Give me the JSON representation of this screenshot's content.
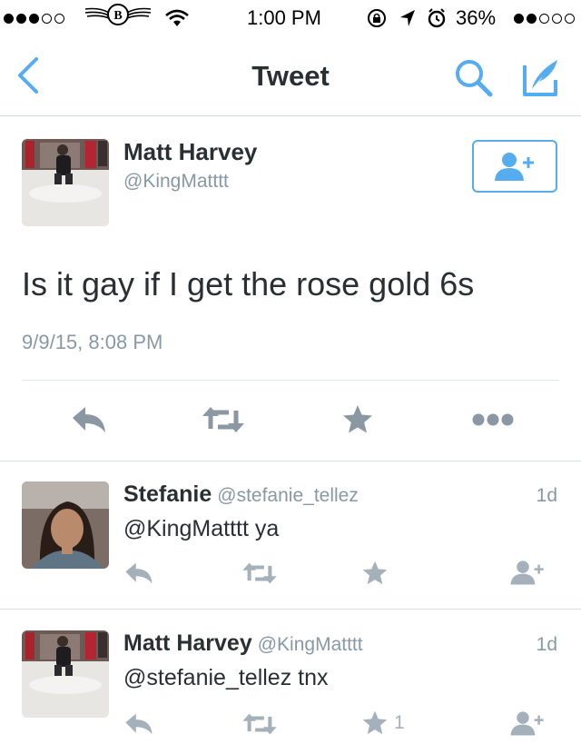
{
  "status_bar": {
    "carrier_signal": "●●●○○",
    "carrier_logo": "B",
    "time": "1:00 PM",
    "battery_percent": "36%",
    "right_signal": "●●○○○"
  },
  "nav": {
    "title": "Tweet",
    "back_icon": "chevron-left-icon",
    "search_icon": "search-icon",
    "compose_icon": "compose-icon"
  },
  "main_tweet": {
    "name": "Matt Harvey",
    "handle": "@KingMatttt",
    "text": "Is it gay if I get the rose gold 6s",
    "timestamp": "9/9/15, 8:08 PM"
  },
  "replies": [
    {
      "name": "Stefanie",
      "handle": "@stefanie_tellez",
      "time": "1d",
      "text": "@KingMatttt ya",
      "favorite_count": ""
    },
    {
      "name": "Matt Harvey",
      "handle": "@KingMatttt",
      "time": "1d",
      "text": "@stefanie_tellez tnx",
      "favorite_count": "1"
    }
  ],
  "colors": {
    "accent": "#55acee",
    "muted": "#8899a6",
    "action_gray": "#a5b1ba",
    "main_action_gray": "#8b98a3"
  }
}
